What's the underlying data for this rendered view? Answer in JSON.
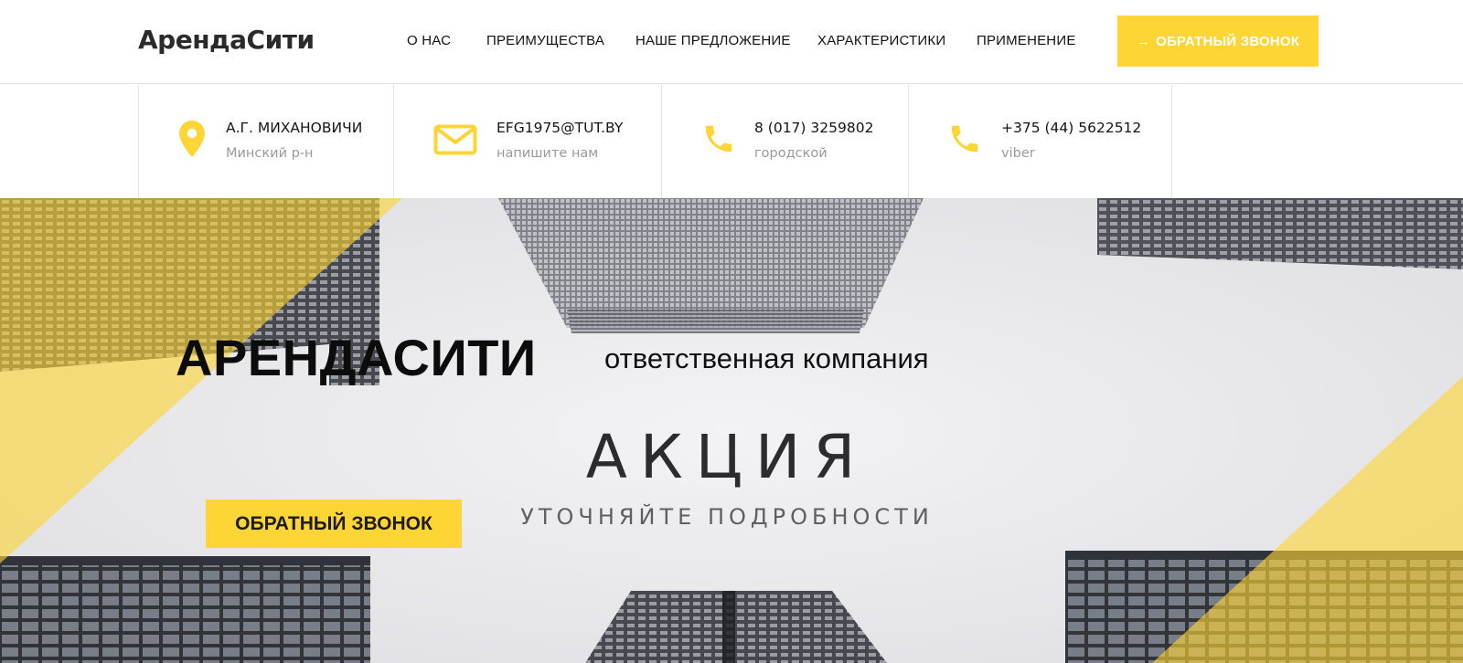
{
  "header": {
    "logo": "АрендаСити",
    "nav": [
      {
        "label": "О НАС"
      },
      {
        "label": "ПРЕИМУЩЕСТВА"
      },
      {
        "label": "НАШЕ ПРЕДЛОЖЕНИЕ"
      },
      {
        "label": "ХАРАКТЕРИСТИКИ"
      },
      {
        "label": "ПРИМЕНЕНИЕ"
      }
    ],
    "cta": {
      "arrow": "→",
      "label": "ОБРАТНЫЙ ЗВОНОК"
    }
  },
  "contacts": [
    {
      "icon": "map-pin-icon",
      "title": "А.Г. МИХАНОВИЧИ",
      "sub": "Минский р-н"
    },
    {
      "icon": "mail-icon",
      "title": "EFG1975@TUT.BY",
      "sub": "напишите нам"
    },
    {
      "icon": "phone-icon",
      "title": "8 (017) 3259802",
      "sub": "городской"
    },
    {
      "icon": "phone-icon",
      "title": "+375 (44) 5622512",
      "sub": "viber"
    }
  ],
  "hero": {
    "brand": "АРЕНДАСИТИ",
    "tagline": "ответственная компания",
    "promo_title": "АКЦИЯ",
    "promo_sub": "УТОЧНЯЙТЕ ПОДРОБНОСТИ",
    "cta": "ОБРАТНЫЙ ЗВОНОК"
  },
  "colors": {
    "accent": "#fdd535",
    "text": "#111111",
    "muted": "#9a9a9a"
  }
}
